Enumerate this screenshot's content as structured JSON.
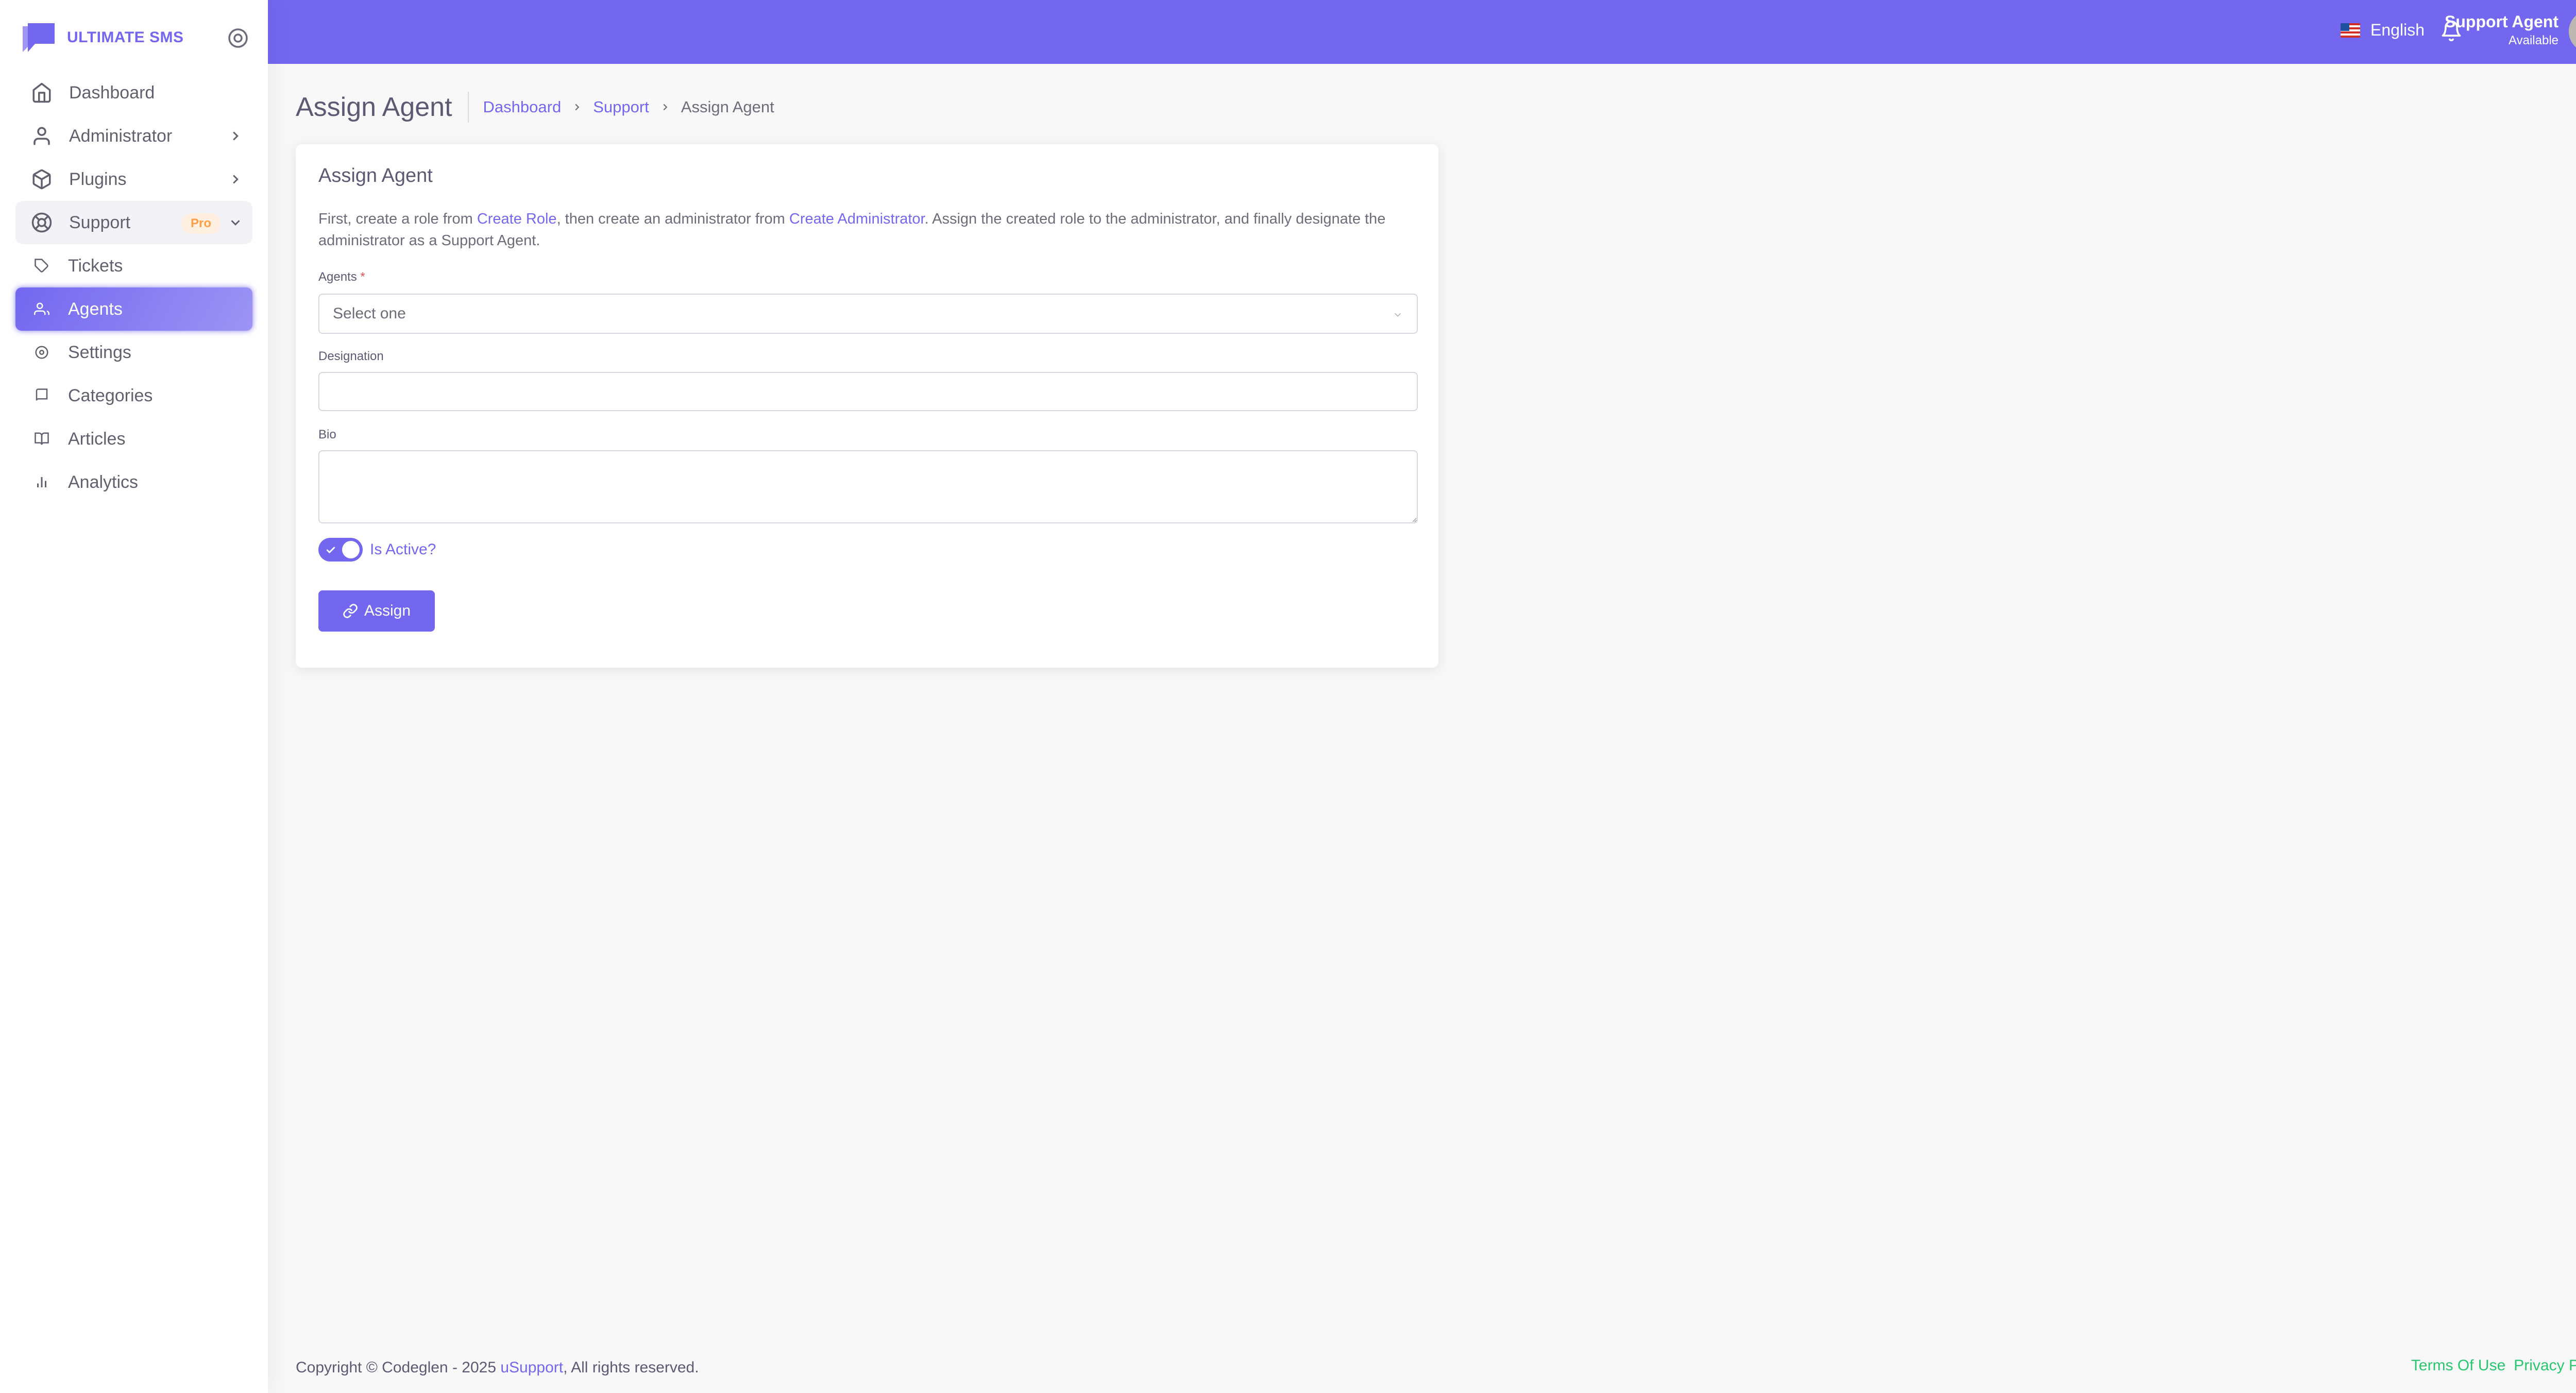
{
  "brand": {
    "name": "ULTIMATE SMS"
  },
  "sidebar": {
    "items": [
      {
        "label": "Dashboard",
        "icon": "home-icon"
      },
      {
        "label": "Administrator",
        "icon": "user-icon"
      },
      {
        "label": "Plugins",
        "icon": "package-icon"
      },
      {
        "label": "Support",
        "icon": "life-buoy-icon",
        "badge": "Pro"
      }
    ],
    "support_sub": [
      {
        "label": "Tickets",
        "icon": "tag-icon"
      },
      {
        "label": "Agents",
        "icon": "users-icon",
        "active": true
      },
      {
        "label": "Settings",
        "icon": "settings-icon"
      },
      {
        "label": "Categories",
        "icon": "book-icon"
      },
      {
        "label": "Articles",
        "icon": "book-open-icon"
      },
      {
        "label": "Analytics",
        "icon": "bar-chart-icon"
      }
    ]
  },
  "navbar": {
    "language": "English",
    "user_name": "Support Agent",
    "user_status": "Available"
  },
  "header": {
    "title": "Assign Agent",
    "breadcrumb": [
      "Dashboard",
      "Support",
      "Assign Agent"
    ]
  },
  "card": {
    "title": "Assign Agent",
    "intro": {
      "part1": "First, create a role from ",
      "link1": "Create Role",
      "part2": ", then create an administrator from ",
      "link2": "Create Administrator",
      "part3": ". Assign the created role to the administrator, and finally designate the administrator as a Support Agent."
    },
    "agents_label": "Agents",
    "agents_required": "*",
    "agents_value": "Select one",
    "designation_label": "Designation",
    "designation_value": "",
    "bio_label": "Bio",
    "bio_value": "",
    "is_active_label": "Is Active?",
    "is_active": true,
    "assign_button": "Assign"
  },
  "footer": {
    "copyright": "Copyright © Codeglen - 2025 ",
    "product": "uSupport",
    "rights": ", All rights reserved.",
    "terms": "Terms Of Use",
    "privacy": "Privacy Policy"
  },
  "colors": {
    "primary": "#7367f0",
    "warning": "#ff9f43",
    "success": "#28c76f",
    "danger": "#ea5455"
  }
}
